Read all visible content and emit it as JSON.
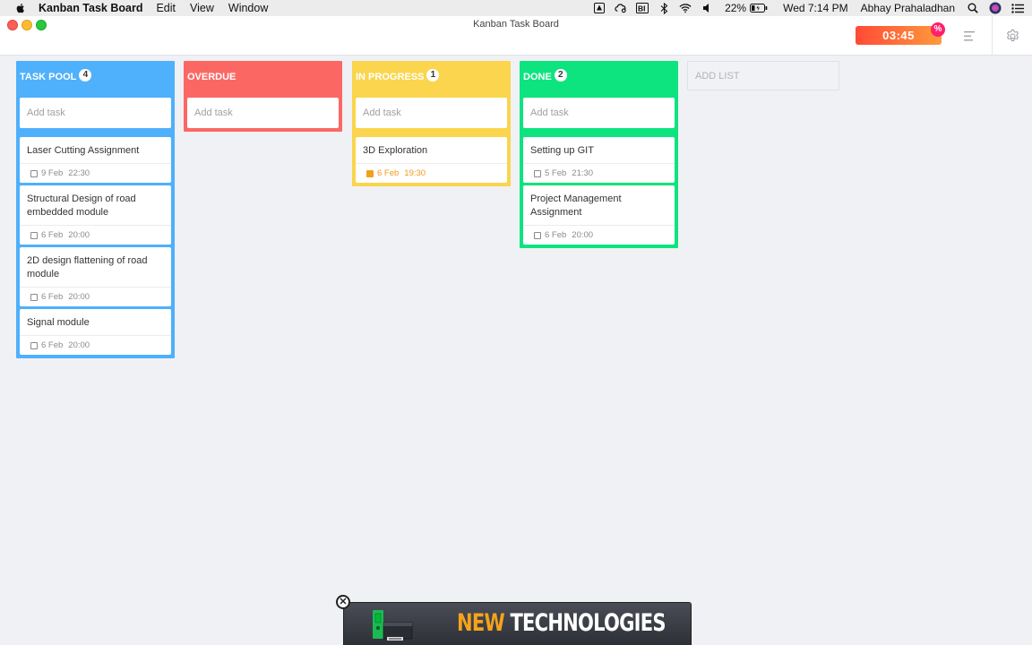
{
  "menubar": {
    "app_name": "Kanban Task Board",
    "items": [
      "Edit",
      "View",
      "Window"
    ],
    "battery": "22%",
    "clock": "Wed 7:14 PM",
    "user": "Abhay Prahaladhan"
  },
  "window": {
    "title": "Kanban Task Board",
    "timer": "03:45",
    "timer_badge": "%"
  },
  "lists": [
    {
      "name": "TASK POOL",
      "count": "4",
      "color": "#4fb0fb",
      "add_placeholder": "Add task",
      "cards": [
        {
          "title": "Laser Cutting Assignment",
          "date": "9 Feb",
          "time": "22:30"
        },
        {
          "title": "Structural Design of road embedded module",
          "date": "6 Feb",
          "time": "20:00"
        },
        {
          "title": "2D design flattening of road module",
          "date": "6 Feb",
          "time": "20:00"
        },
        {
          "title": "Signal module",
          "date": "6 Feb",
          "time": "20:00"
        }
      ]
    },
    {
      "name": "OVERDUE",
      "count": "",
      "color": "#fb6863",
      "add_placeholder": "Add task",
      "cards": []
    },
    {
      "name": "IN PROGRESS",
      "count": "1",
      "color": "#fad54d",
      "add_placeholder": "Add task",
      "cards": [
        {
          "title": "3D Exploration",
          "date": "6 Feb",
          "time": "19:30"
        }
      ]
    },
    {
      "name": "DONE",
      "count": "2",
      "color": "#0de47f",
      "add_placeholder": "Add task",
      "cards": [
        {
          "title": "Setting up GIT",
          "date": "5 Feb",
          "time": "21:30"
        },
        {
          "title": "Project Management Assignment",
          "date": "6 Feb",
          "time": "20:00"
        }
      ]
    }
  ],
  "add_list_label": "ADD LIST",
  "ad": {
    "accent_word": "NEW",
    "rest": " TECHNOLOGIES",
    "close_glyph": "✕"
  }
}
